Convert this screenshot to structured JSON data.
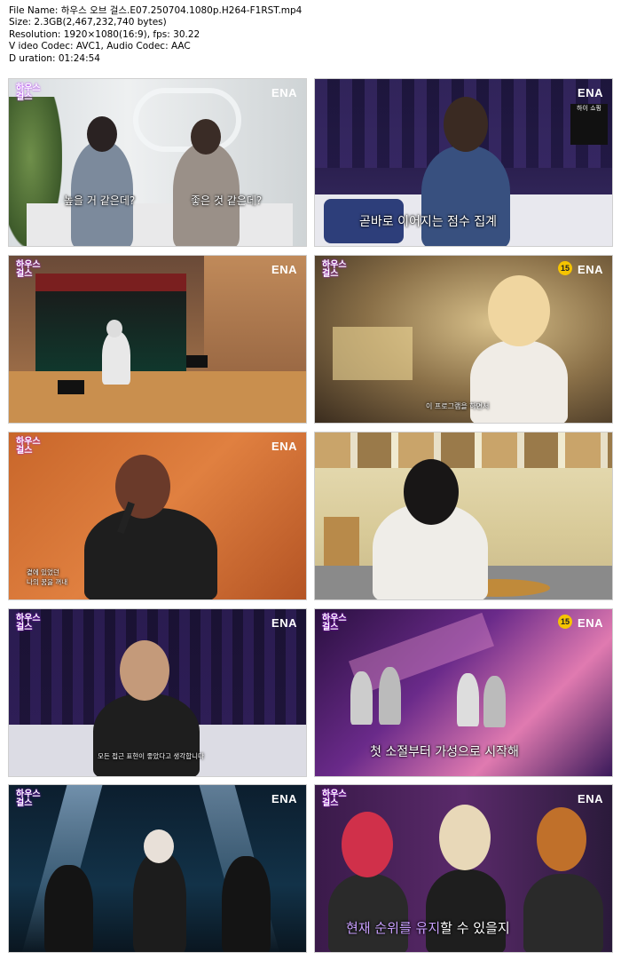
{
  "meta": {
    "file_name": "File Name: 하우스 오브 걸스.E07.250704.1080p.H264-F1RST.mp4",
    "size": "Size: 2.3GB(2,467,232,740 bytes)",
    "resolution": "Resolution: 1920×1080(16:9), fps: 30.22",
    "codecs": "V ideo Codec: AVC1, Audio Codec: AAC",
    "duration": "D uration: 01:24:54"
  },
  "logo": {
    "show_line1": "하우스",
    "show_line2": "걸스",
    "network": "ENA"
  },
  "rating": "15",
  "tiles": [
    {
      "caption_left": "높을 거 같은데?",
      "caption_right": "좋은 것 같은데?"
    },
    {
      "caption": "곧바로 이어지는 점수 집계",
      "side_badge": "하이 쇼핑"
    },
    {},
    {
      "caption": "이 프로그램을 하면서"
    },
    {
      "caption_line1": "곁에 있었던",
      "caption_line2": "나의 꿈을 꺼내"
    },
    {},
    {
      "caption": "모든 접근 표현이 좋았다고 생각합니다"
    },
    {
      "caption": "첫 소절부터 가성으로 시작해"
    },
    {},
    {
      "caption_pre": "현재 순위를 유지",
      "caption_post": "할 수 있을지"
    }
  ]
}
